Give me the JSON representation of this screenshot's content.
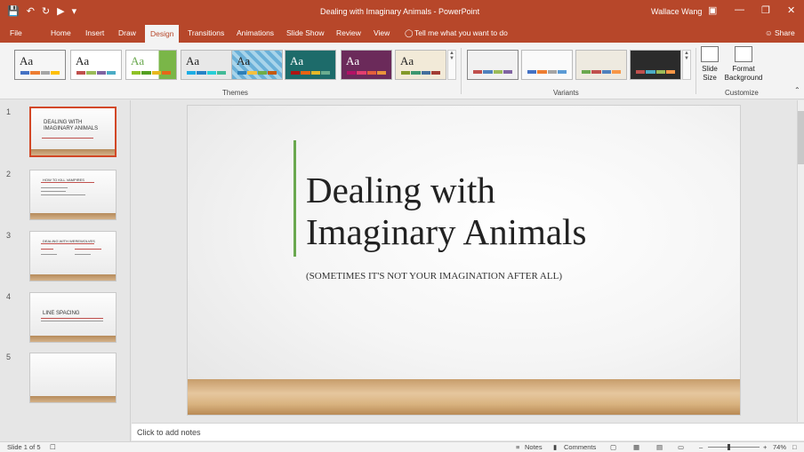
{
  "window": {
    "title": "Dealing with Imaginary Animals  -  PowerPoint",
    "user": "Wallace Wang"
  },
  "qat": {
    "save_icon": "save-icon",
    "undo_icon": "undo-icon",
    "redo_icon": "redo-icon"
  },
  "tabs": [
    "File",
    "Home",
    "Insert",
    "Draw",
    "Design",
    "Transitions",
    "Animations",
    "Slide Show",
    "Review",
    "View"
  ],
  "tell_me": "Tell me what you want to do",
  "share": "Share",
  "ribbon": {
    "themes_label": "Themes",
    "variants_label": "Variants",
    "customize_label": "Customize",
    "theme_glyph": "Aa",
    "slide_size_label": "Slide Size",
    "format_background_label": "Format Background"
  },
  "colors": {
    "accent": "#b7472a",
    "selection": "#d24726",
    "title_bar_green": "#6aa84f"
  },
  "slides": [
    {
      "number": "1",
      "title": "DEALING WITH IMAGINARY ANIMALS"
    },
    {
      "number": "2",
      "title": "HOW TO KILL VAMPIRES"
    },
    {
      "number": "3",
      "title": "DEALING WITH WEREWOLVES"
    },
    {
      "number": "4",
      "title": "LINE SPACING"
    },
    {
      "number": "5",
      "title": ""
    }
  ],
  "current_slide": {
    "title_line1": "Dealing with",
    "title_line2": "Imaginary Animals",
    "subtitle": "(SOMETIMES IT'S NOT YOUR IMAGINATION AFTER ALL)"
  },
  "notes_placeholder": "Click to add notes",
  "status": {
    "slide_counter": "Slide 1 of 5",
    "notes": "Notes",
    "comments": "Comments",
    "zoom": "74%"
  }
}
